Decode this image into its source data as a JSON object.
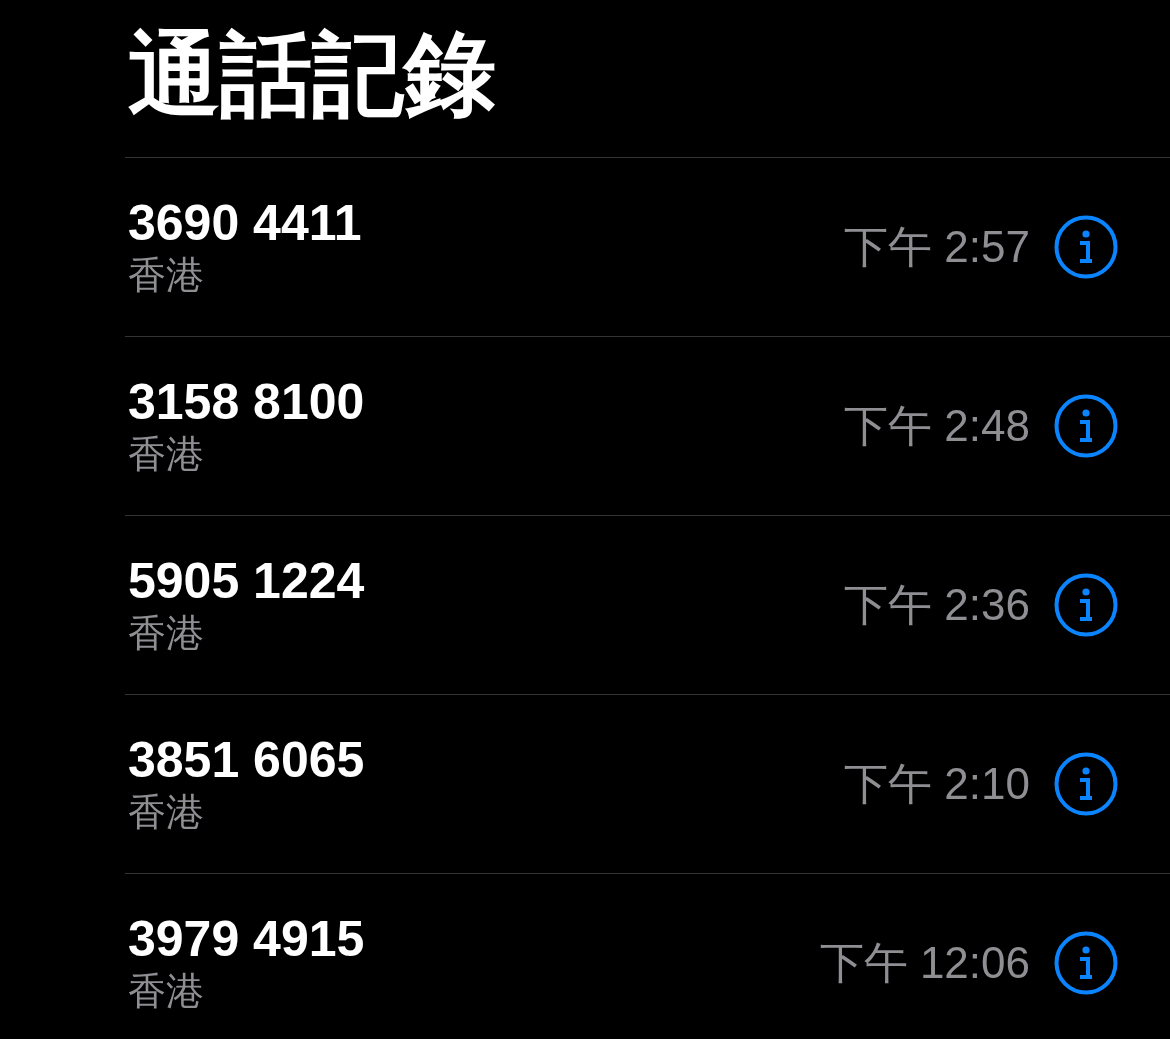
{
  "title": "通話記錄",
  "calls": [
    {
      "number": "3690 4411",
      "location": "香港",
      "time": "下午 2:57"
    },
    {
      "number": "3158 8100",
      "location": "香港",
      "time": "下午 2:48"
    },
    {
      "number": "5905 1224",
      "location": "香港",
      "time": "下午 2:36"
    },
    {
      "number": "3851 6065",
      "location": "香港",
      "time": "下午 2:10"
    },
    {
      "number": "3979 4915",
      "location": "香港",
      "time": "下午 12:06"
    }
  ]
}
